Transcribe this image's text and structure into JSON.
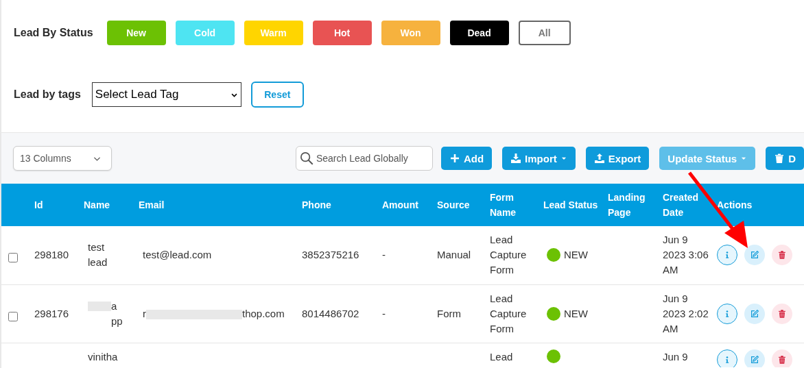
{
  "status_filter": {
    "label": "Lead By Status",
    "buttons": [
      {
        "label": "New",
        "kind": "filled",
        "color": "#6cc104"
      },
      {
        "label": "Cold",
        "kind": "filled",
        "color": "#4ee4f2"
      },
      {
        "label": "Warm",
        "kind": "filled",
        "color": "#ffd500"
      },
      {
        "label": "Hot",
        "kind": "filled",
        "color": "#e85353"
      },
      {
        "label": "Won",
        "kind": "filled",
        "color": "#f6b23e"
      },
      {
        "label": "Dead",
        "kind": "filled",
        "color": "#000000"
      },
      {
        "label": "All",
        "kind": "outline",
        "color": "#ffffff"
      }
    ]
  },
  "tag_filter": {
    "label": "Lead by tags",
    "select": "Select Lead Tag",
    "reset": "Reset"
  },
  "toolbar": {
    "columns_select": "13 Columns",
    "search": {
      "placeholder": "Search Lead Globally"
    },
    "buttons": [
      {
        "label": "Add",
        "kind": "add",
        "disabled": false,
        "caret": false
      },
      {
        "label": "Import",
        "kind": "import",
        "disabled": false,
        "caret": true
      },
      {
        "label": "Export",
        "kind": "export",
        "disabled": false,
        "caret": false
      },
      {
        "label": "Update Status",
        "kind": "status",
        "disabled": true,
        "caret": true
      },
      {
        "label": "D",
        "kind": "delete",
        "disabled": false,
        "caret": false
      }
    ]
  },
  "table": {
    "columns": [
      "Id",
      "Name",
      "Email",
      "Phone",
      "Amount",
      "Source",
      "Form Name",
      "Lead Status",
      "Landing Page",
      "Created Date",
      "Actions"
    ],
    "rows": [
      {
        "checked": false,
        "id": "298180",
        "name": [
          {
            "kind": "text",
            "text": "test lead"
          }
        ],
        "email": [
          {
            "kind": "text",
            "text": "test@lead.com"
          }
        ],
        "phone": "3852375216",
        "amount": "-",
        "source": "Manual",
        "form_name": "Lead Capture Form",
        "status": {
          "label": "NEW",
          "color": "#6cc104"
        },
        "created": "Jun 9 2023 3:06 AM"
      },
      {
        "checked": false,
        "id": "298176",
        "name": [
          {
            "kind": "redaction"
          },
          {
            "kind": "text",
            "text": "a pp"
          }
        ],
        "email": [
          {
            "kind": "text",
            "text": "r"
          },
          {
            "kind": "redaction"
          },
          {
            "kind": "text",
            "text": "thop.com"
          }
        ],
        "phone": "8014486702",
        "amount": "-",
        "source": "Form",
        "form_name": "Lead Capture Form",
        "status": {
          "label": "NEW",
          "color": "#6cc104"
        },
        "created": "Jun 9 2023 2:02 AM"
      },
      {
        "name": [
          {
            "kind": "text",
            "text": "vinitha"
          }
        ],
        "form_name": "Lead",
        "status": {
          "color": "#6cc104"
        },
        "created": "Jun 9"
      }
    ]
  },
  "annotation": {
    "kind": "arrow"
  }
}
